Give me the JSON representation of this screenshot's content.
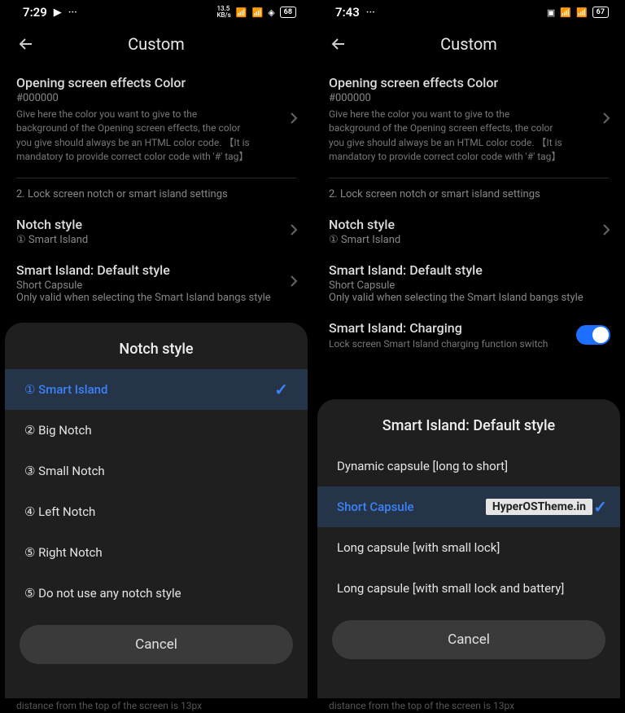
{
  "left": {
    "status": {
      "time": "7:29",
      "battery": "68"
    },
    "header": "Custom",
    "opening": {
      "title": "Opening screen effects Color",
      "code": "#000000",
      "desc": "Give here the color you want to give to the background of the Opening screen effects, the color you give should always be an HTML color code. 【It is mandatory to provide correct color code with '#' tag】"
    },
    "section_label": "2. Lock screen notch or smart island settings",
    "notch": {
      "title": "Notch style",
      "sub": "① Smart Island"
    },
    "default_style": {
      "title": "Smart Island: Default style",
      "sub": "Short Capsule",
      "desc": "Only valid when selecting the Smart Island bangs style"
    },
    "sheet": {
      "title": "Notch style",
      "items": [
        {
          "label": "① Smart Island",
          "selected": true
        },
        {
          "label": "② Big Notch",
          "selected": false
        },
        {
          "label": "③ Small Notch",
          "selected": false
        },
        {
          "label": "④ Left Notch",
          "selected": false
        },
        {
          "label": "⑤ Right Notch",
          "selected": false
        },
        {
          "label": "⑤ Do not use any notch style",
          "selected": false
        }
      ],
      "cancel": "Cancel"
    },
    "footer": "distance from the top of the screen is 13px"
  },
  "right": {
    "status": {
      "time": "7:43",
      "battery": "67"
    },
    "header": "Custom",
    "opening": {
      "title": "Opening screen effects Color",
      "code": "#000000",
      "desc": "Give here the color you want to give to the background of the Opening screen effects, the color you give should always be an HTML color code. 【It is mandatory to provide correct color code with '#' tag】"
    },
    "section_label": "2. Lock screen notch or smart island settings",
    "notch": {
      "title": "Notch style",
      "sub": "① Smart Island"
    },
    "default_style": {
      "title": "Smart Island: Default style",
      "sub": "Short Capsule",
      "desc": "Only valid when selecting the Smart Island bangs style"
    },
    "charging": {
      "title": "Smart Island: Charging",
      "desc": "Lock screen Smart Island charging function switch"
    },
    "sheet": {
      "title": "Smart Island: Default style",
      "items": [
        {
          "label": "Dynamic capsule [long to short]",
          "selected": false
        },
        {
          "label": "Short Capsule",
          "selected": true
        },
        {
          "label": "Long capsule [with small lock]",
          "selected": false
        },
        {
          "label": "Long capsule [with small lock and battery]",
          "selected": false
        }
      ],
      "cancel": "Cancel"
    },
    "badge": "HyperOSTheme.in",
    "footer": "distance from the top of the screen is 13px"
  }
}
